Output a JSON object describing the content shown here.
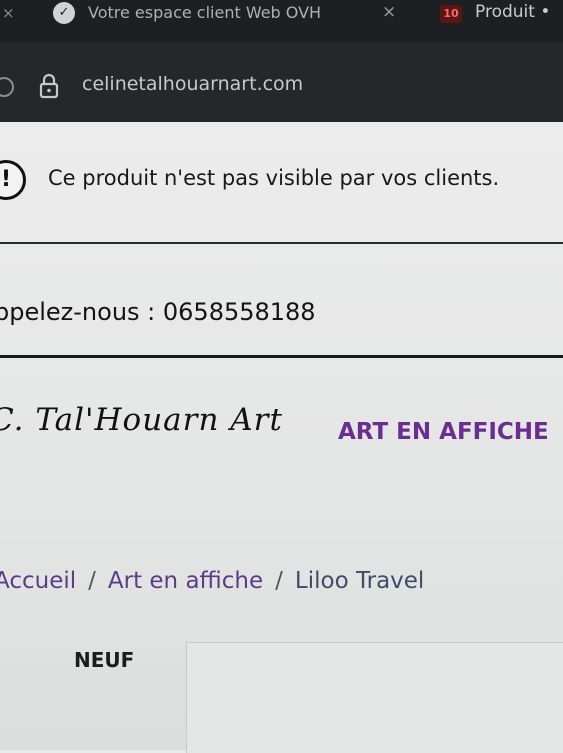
{
  "browser": {
    "tab_close_left": "×",
    "tab_icon_glyph": "✓",
    "tab_title": "Votre espace client Web OVH",
    "tab_close": "×",
    "tab2_badge": "10",
    "tab2_title": "Produit •",
    "url": "celinetalhouarnart.com"
  },
  "notice": {
    "icon": "!",
    "text": "Ce produit n'est pas visible par vos clients."
  },
  "header": {
    "phone": "ppelez-nous : 0658558188",
    "logo": "C. Tal'Houarn Art",
    "nav_item": "ART EN AFFICHE"
  },
  "breadcrumb": {
    "items": [
      "Accueil",
      "Art en affiche",
      "Liloo Travel"
    ],
    "separator": "/"
  },
  "product": {
    "badge": "NEUF"
  },
  "colors": {
    "nav_accent": "#6a2e8f",
    "breadcrumb_link": "#5d3b86"
  }
}
